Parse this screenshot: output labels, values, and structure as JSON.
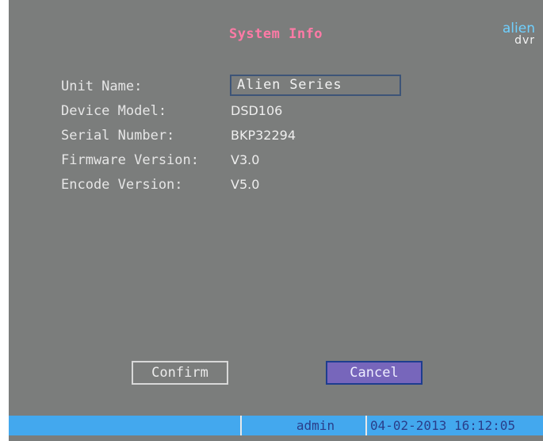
{
  "window": {
    "title": "System Info"
  },
  "logo": {
    "line1": "alien",
    "line2": "dvr"
  },
  "fields": [
    {
      "label": "Unit Name:",
      "value": "Alien Series"
    },
    {
      "label": "Device Model:",
      "value": "DSD106"
    },
    {
      "label": "Serial Number:",
      "value": "BKP32294"
    },
    {
      "label": "Firmware Version:",
      "value": "V3.0"
    },
    {
      "label": "Encode Version:",
      "value": "V5.0"
    }
  ],
  "buttons": {
    "confirm": "Confirm",
    "cancel": "Cancel"
  },
  "status_bar": {
    "user": "admin",
    "datetime": "04-02-2013 16:12:05"
  },
  "colors": {
    "background": "#7b7d7c",
    "title": "#ff7aa6",
    "status_bar": "#43a8ee",
    "cancel_button": "#7766bb"
  }
}
